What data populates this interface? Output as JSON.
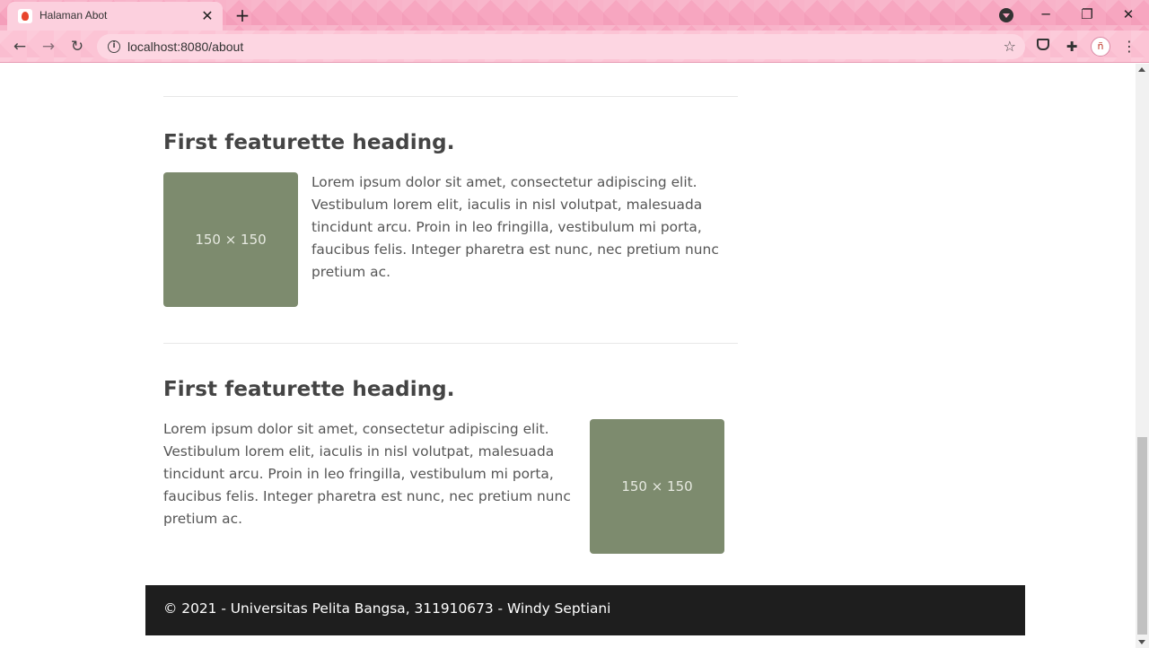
{
  "browser": {
    "tab_title": "Halaman Abot",
    "tab_close": "✕",
    "new_tab": "+",
    "url": "localhost:8080/about",
    "window_controls": {
      "minimize": "─",
      "maximize": "❐",
      "close": "✕"
    },
    "avatar_text": "ñ",
    "theme_color": "#f7a6c0"
  },
  "page": {
    "features": [
      {
        "heading": "First featurette heading.",
        "image_label": "150 × 150",
        "image_position": "left",
        "text": "Lorem ipsum dolor sit amet, consectetur adipiscing elit. Vestibulum lorem elit, iaculis in nisl volutpat, malesuada tincidunt arcu. Proin in leo fringilla, vestibulum mi porta, faucibus felis. Integer pharetra est nunc, nec pretium nunc pretium ac."
      },
      {
        "heading": "First featurette heading.",
        "image_label": "150 × 150",
        "image_position": "right",
        "text": "Lorem ipsum dolor sit amet, consectetur adipiscing elit. Vestibulum lorem elit, iaculis in nisl volutpat, malesuada tincidunt arcu. Proin in leo fringilla, vestibulum mi porta, faucibus felis. Integer pharetra est nunc, nec pretium nunc pretium ac."
      }
    ],
    "footer": "© 2021 - Universitas Pelita Bangsa, 311910673 - Windy Septiani",
    "placeholder_color": "#7d8b6e",
    "footer_color": "#1e1e1e"
  }
}
